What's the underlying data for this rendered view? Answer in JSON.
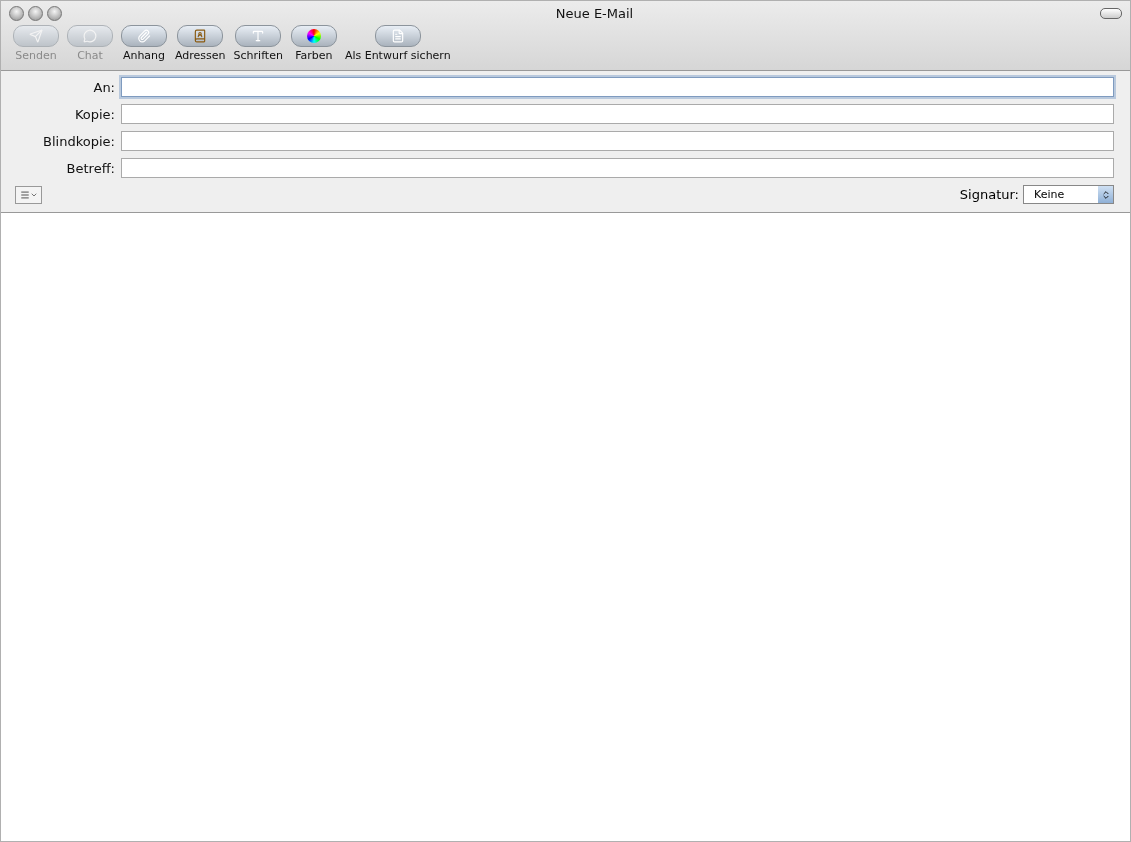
{
  "window": {
    "title": "Neue E-Mail"
  },
  "toolbar": [
    {
      "kind": "send",
      "label": "Senden",
      "disabled": true
    },
    {
      "kind": "chat",
      "label": "Chat",
      "disabled": true
    },
    {
      "kind": "attach",
      "label": "Anhang",
      "disabled": false
    },
    {
      "kind": "addresses",
      "label": "Adressen",
      "disabled": false
    },
    {
      "kind": "fonts",
      "label": "Schriften",
      "disabled": false
    },
    {
      "kind": "colors",
      "label": "Farben",
      "disabled": false
    },
    {
      "kind": "draft",
      "label": "Als Entwurf sichern",
      "disabled": false
    }
  ],
  "fields": [
    {
      "label": "An:",
      "focused": true
    },
    {
      "label": "Kopie:",
      "focused": false
    },
    {
      "label": "Blindkopie:",
      "focused": false
    },
    {
      "label": "Betreff:",
      "focused": false
    }
  ],
  "signature": {
    "label": "Signatur:",
    "value": "Keine"
  }
}
